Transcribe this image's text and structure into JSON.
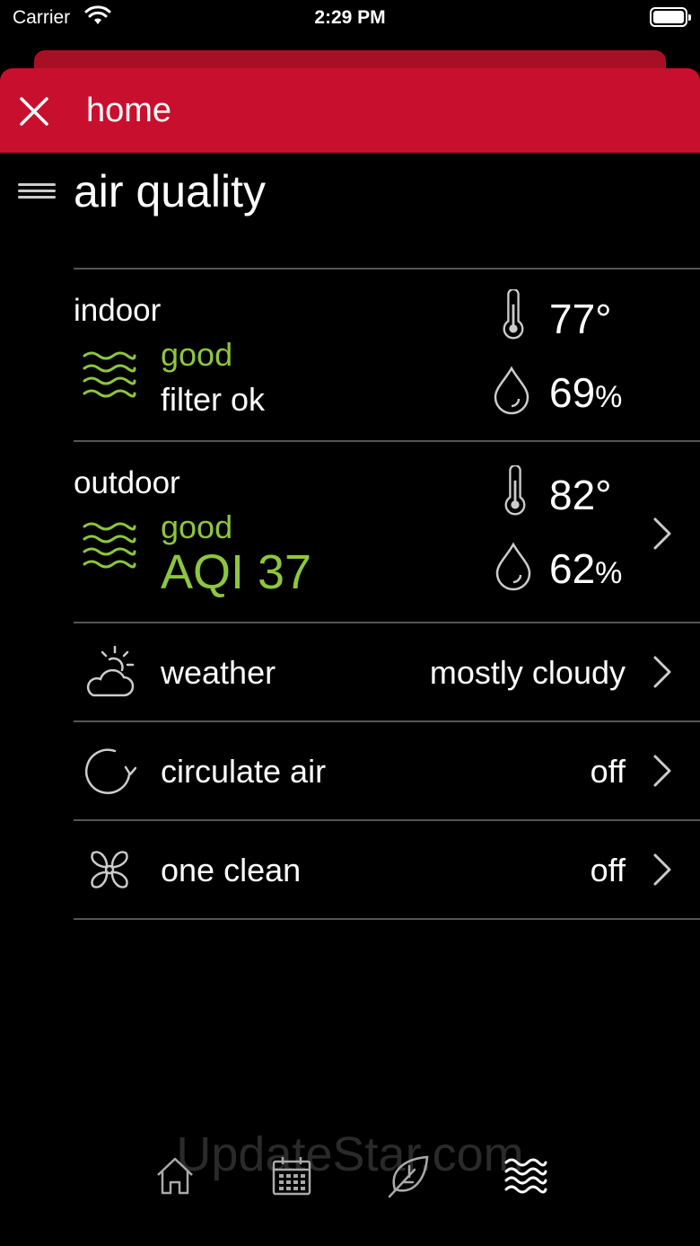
{
  "status_bar": {
    "carrier": "Carrier",
    "time": "2:29 PM"
  },
  "header": {
    "title": "home"
  },
  "page": {
    "title": "air quality"
  },
  "indoor": {
    "label": "indoor",
    "status": "good",
    "filter": "filter ok",
    "temperature": "77°",
    "humidity": "69",
    "humidity_unit": "%"
  },
  "outdoor": {
    "label": "outdoor",
    "status": "good",
    "aqi": "AQI 37",
    "temperature": "82°",
    "humidity": "62",
    "humidity_unit": "%"
  },
  "rows": [
    {
      "label": "weather",
      "value": "mostly cloudy",
      "icon": "partly-cloudy-icon"
    },
    {
      "label": "circulate air",
      "value": "off",
      "icon": "circulate-icon"
    },
    {
      "label": "one clean",
      "value": "off",
      "icon": "fan-icon"
    }
  ],
  "tabs": [
    {
      "name": "home",
      "icon": "home-icon"
    },
    {
      "name": "schedule",
      "icon": "calendar-icon"
    },
    {
      "name": "eco",
      "icon": "leaf-icon"
    },
    {
      "name": "air quality",
      "icon": "waves-icon"
    }
  ],
  "watermark": "UpdateStar.com",
  "colors": {
    "accent": "#c8102e",
    "good": "#8dc63f",
    "divider": "#555555"
  }
}
